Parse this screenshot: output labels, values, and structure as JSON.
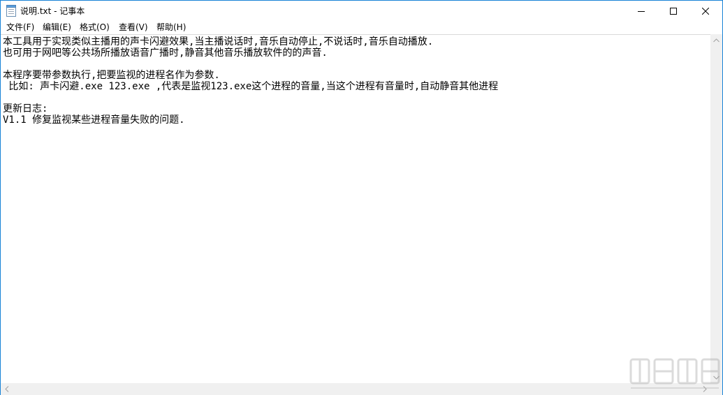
{
  "window": {
    "title": "说明.txt - 记事本",
    "icon": "notepad-icon",
    "controls": {
      "minimize": "minimize-icon",
      "maximize": "maximize-icon",
      "close": "close-icon"
    }
  },
  "menu": {
    "file": "文件(F)",
    "edit": "编辑(E)",
    "format": "格式(O)",
    "view": "查看(V)",
    "help": "帮助(H)"
  },
  "document": {
    "lines": [
      "本工具用于实现类似主播用的声卡闪避效果,当主播说话时,音乐自动停止,不说话时,音乐自动播放.",
      "也可用于网吧等公共场所播放语音广播时,静音其他音乐播放软件的的声音.",
      "",
      "本程序要带参数执行,把要监视的进程名作为参数.",
      " 比如: 声卡闪避.exe 123.exe ,代表是监视123.exe这个进程的音量,当这个进程有音量时,自动静音其他进程",
      "",
      "更新日志:",
      "V1.1 修复监视某些进程音量失败的问题."
    ]
  },
  "scrollbars": {
    "up": "scroll-up-arrow-icon",
    "down": "scroll-down-arrow-icon",
    "left": "scroll-left-arrow-icon",
    "right": "scroll-right-arrow-icon"
  },
  "colors": {
    "window_border": "#1883d7",
    "scrollbar_bg": "#f0f0f0",
    "text": "#000000"
  }
}
